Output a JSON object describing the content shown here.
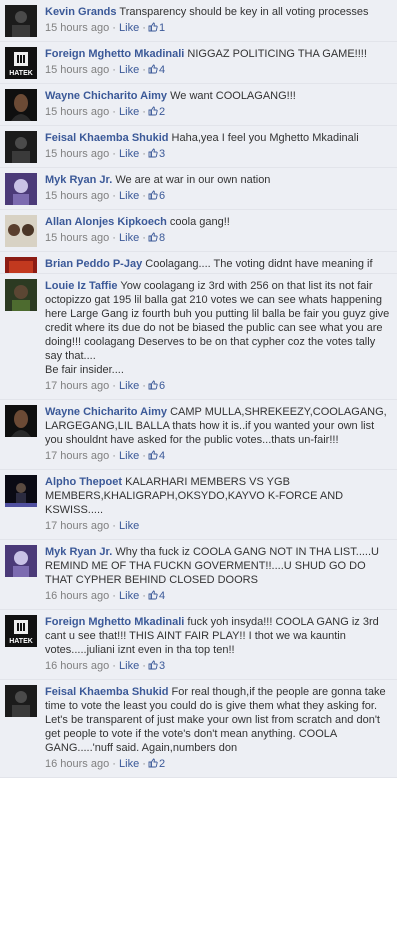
{
  "comments": [
    {
      "author": "Kevin Grands",
      "text": "Transparency should be key in all voting processes",
      "time": "15 hours ago",
      "like_label": "Like",
      "likes": "1",
      "avatar": "dark"
    },
    {
      "author": "Foreign Mghetto Mkadinali",
      "text": "NIGGAZ POLITICING THA GAME!!!!",
      "time": "15 hours ago",
      "like_label": "Like",
      "likes": "4",
      "avatar": "hatek",
      "avatar_text": "HATEK"
    },
    {
      "author": "Wayne Chicharito Aimy",
      "text": "We want COOLAGANG!!!",
      "time": "15 hours ago",
      "like_label": "Like",
      "likes": "2",
      "avatar": "woman"
    },
    {
      "author": "Feisal Khaemba Shukid",
      "text": "Haha,yea I feel you Mghetto Mkadinali",
      "time": "15 hours ago",
      "like_label": "Like",
      "likes": "3",
      "avatar": "dark"
    },
    {
      "author": "Myk Ryan Jr.",
      "text": "We are at war in our own nation",
      "time": "15 hours ago",
      "like_label": "Like",
      "likes": "6",
      "avatar": "purple"
    },
    {
      "author": "Allan Alonjes Kipkoech",
      "text": "coola gang!!",
      "time": "15 hours ago",
      "like_label": "Like",
      "likes": "8",
      "avatar": "faces"
    },
    {
      "author": "Brian Peddo P-Jay",
      "text": "Coolagang.... The voting didnt have meaning if",
      "time": "",
      "like_label": "",
      "likes": "",
      "avatar": "red"
    },
    {
      "author": "Louie Iz Taffie",
      "text": "Yow coolagang iz 3rd with 256 on that list its not fair octopizzo gat 195 lil balla gat 210 votes we can see whats happening here Large Gang iz fourth buh you putting lil balla be fair you guyz give credit where its due do not be biased the public can see what you are doing!!! coolagang Deserves to be on that cypher coz the votes tally say that....",
      "text2": "Be fair insider....",
      "time": "17 hours ago",
      "like_label": "Like",
      "likes": "6",
      "avatar": "green"
    },
    {
      "author": "Wayne Chicharito Aimy",
      "text": "CAMP MULLA,SHREKEEZY,COOLAGANG, LARGEGANG,LIL BALLA thats how it is..if you wanted your own list you shouldnt have asked for the public votes...thats un-fair!!!",
      "time": "17 hours ago",
      "like_label": "Like",
      "likes": "4",
      "avatar": "woman"
    },
    {
      "author": "Alpho Thepoet",
      "text": "KALARHARI MEMBERS VS YGB MEMBERS,KHALIGRAPH,OKSYDO,KAYVO K-FORCE AND KSWISS.....",
      "time": "17 hours ago",
      "like_label": "Like",
      "likes": "",
      "avatar": "stage"
    },
    {
      "author": "Myk Ryan Jr.",
      "text": "Why tha fuck iz COOLA GANG NOT IN THA LIST.....U REMIND ME OF THA FUCKN GOVERMENT!!....U SHUD GO DO THAT CYPHER BEHIND CLOSED DOORS",
      "time": "16 hours ago",
      "like_label": "Like",
      "likes": "4",
      "avatar": "purple"
    },
    {
      "author": "Foreign Mghetto Mkadinali",
      "text": "fuck yoh insyda!!! COOLA GANG iz 3rd cant u see that!!! THIS AINT FAIR PLAY!! I thot we wa kauntin votes.....juliani iznt even in tha top ten!!",
      "time": "16 hours ago",
      "like_label": "Like",
      "likes": "3",
      "avatar": "hatek",
      "avatar_text": "HATEK"
    },
    {
      "author": "Feisal Khaemba Shukid",
      "text": "For real though,if the people are gonna take time to vote the least you could do is give them what they asking for. Let's be transparent of just make your own list from scratch and don't get people to vote if the vote's don't mean anything. COOLA GANG.....'nuff said. Again,numbers don",
      "time": "16 hours ago",
      "like_label": "Like",
      "likes": "2",
      "avatar": "dark"
    }
  ],
  "separator": "·",
  "colors": {
    "link": "#3b5998",
    "meta": "#808080",
    "text": "#333333",
    "background": "#edeff4"
  }
}
